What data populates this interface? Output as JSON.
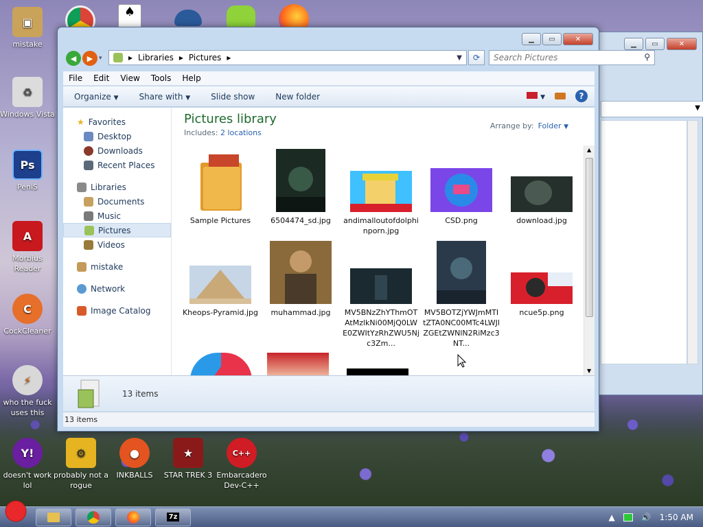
{
  "desktop_icons": [
    {
      "label": "mistake",
      "icon": "folder-user-icon",
      "color": "#caa35a"
    },
    {
      "label": "Windows Vista",
      "icon": "recycle-bin-icon",
      "color": "#dcdcdc"
    },
    {
      "label": "PeniS",
      "icon": "photoshop-icon",
      "color": "#1d3f8c"
    },
    {
      "label": "Morbius Reader",
      "icon": "pdf-reader-icon",
      "color": "#c8191e"
    },
    {
      "label": "CockCleaner",
      "icon": "cleaner-icon",
      "color": "#e66f2a"
    },
    {
      "label": "who the fuck uses this",
      "icon": "flash-icon",
      "color": "#d8d8d8"
    },
    {
      "label": "doesn't work lol",
      "icon": "yahoo-messenger-icon",
      "color": "#6a1ea0"
    },
    {
      "label": "probably not a rogue",
      "icon": "system-tool-icon",
      "color": "#e6b420"
    },
    {
      "label": "INKBALLS",
      "icon": "inkball-icon",
      "color": "#e35420"
    },
    {
      "label": "STAR TREK 3",
      "icon": "star-trek-icon",
      "color": "#8a1a1a"
    },
    {
      "label": "Embarcadero Dev-C++",
      "icon": "devcpp-icon",
      "color": "#d01c24"
    }
  ],
  "explorer": {
    "breadcrumb": [
      "Libraries",
      "Pictures"
    ],
    "search_placeholder": "Search Pictures",
    "menu": [
      "File",
      "Edit",
      "View",
      "Tools",
      "Help"
    ],
    "toolbar": [
      "Organize",
      "Share with",
      "Slide show",
      "New folder"
    ],
    "nav": {
      "favorites": "Favorites",
      "favorite_items": [
        "Desktop",
        "Downloads",
        "Recent Places"
      ],
      "libraries": "Libraries",
      "library_items": [
        "Documents",
        "Music",
        "Pictures",
        "Videos"
      ],
      "user": "mistake",
      "network": "Network",
      "catalog": "Image Catalog"
    },
    "library_title": "Pictures library",
    "includes_label": "Includes:",
    "includes_link": "2 locations",
    "arrange_label": "Arrange by:",
    "arrange_value": "Folder",
    "files": [
      {
        "name": "Sample Pictures",
        "kind": "folder"
      },
      {
        "name": "6504474_sd.jpg",
        "kind": "poster",
        "color": "#1c2a24"
      },
      {
        "name": "andimalloutofdolphinporn.jpg",
        "kind": "cartoon",
        "color": "#e8d23a"
      },
      {
        "name": "CSD.png",
        "kind": "badge",
        "color": "#7a46e8"
      },
      {
        "name": "download.jpg",
        "kind": "dark",
        "color": "#25302c"
      },
      {
        "name": "Kheops-Pyramid.jpg",
        "kind": "pyramid",
        "color": "#c9a978"
      },
      {
        "name": "muhammad.jpg",
        "kind": "painting",
        "color": "#8a5a2a"
      },
      {
        "name": "MV5BNzZhYThmOTAtMzlkNi00MjQ0LWE0ZWItYzRhZWU5Njc3Zm...",
        "kind": "dark",
        "color": "#1a2a30"
      },
      {
        "name": "MV5BOTZjYWJmMTItZTA0NC00MTc4LWJlZGEtZWNlN2RiMzc3NT...",
        "kind": "poster",
        "color": "#2a3a4a"
      },
      {
        "name": "ncue5p.png",
        "kind": "flag",
        "color": "#d8202c"
      }
    ],
    "items_count": "13 items",
    "status_count": "13 items"
  },
  "taskbar": {
    "time": "1:50 AM"
  }
}
